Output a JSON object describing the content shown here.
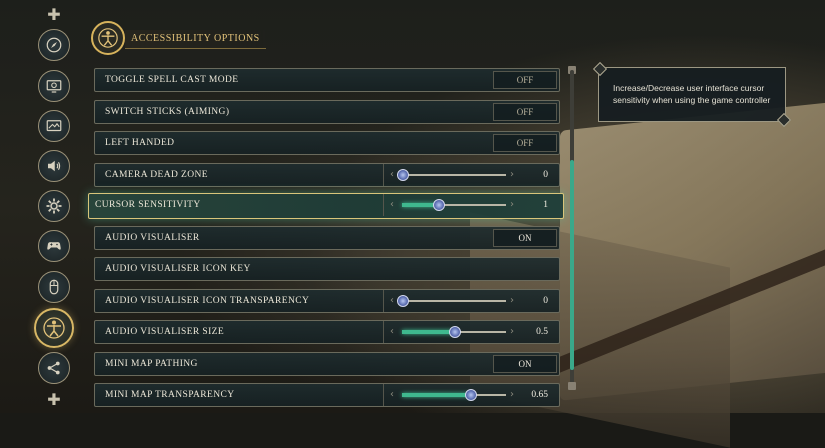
{
  "header": {
    "title": "ACCESSIBILITY OPTIONS",
    "emblem_icon": "vitruvian-man-icon"
  },
  "sidebar": {
    "items": [
      {
        "icon": "compass-icon",
        "active": false
      },
      {
        "icon": "display-icon",
        "active": false
      },
      {
        "icon": "graphics-icon",
        "active": false
      },
      {
        "icon": "speaker-icon",
        "active": false
      },
      {
        "icon": "gear-icon",
        "active": false
      },
      {
        "icon": "gamepad-icon",
        "active": false
      },
      {
        "icon": "mouse-icon",
        "active": false
      },
      {
        "icon": "vitruvian-man-icon",
        "active": true
      },
      {
        "icon": "network-icon",
        "active": false
      }
    ]
  },
  "settings": [
    {
      "label": "TOGGLE SPELL CAST MODE",
      "type": "toggle",
      "value": "OFF"
    },
    {
      "label": "SWITCH STICKS (AIMING)",
      "type": "toggle",
      "value": "OFF"
    },
    {
      "label": "LEFT HANDED",
      "type": "toggle",
      "value": "OFF"
    },
    {
      "label": "CAMERA DEAD ZONE",
      "type": "slider",
      "value": "0",
      "fraction": 0.0
    },
    {
      "label": "CURSOR SENSITIVITY",
      "type": "slider",
      "value": "1",
      "fraction": 0.35,
      "selected": true
    },
    {
      "label": "AUDIO VISUALISER",
      "type": "toggle",
      "value": "ON"
    },
    {
      "label": "AUDIO VISUALISER ICON KEY",
      "type": "link"
    },
    {
      "label": "AUDIO VISUALISER ICON TRANSPARENCY",
      "type": "slider",
      "value": "0",
      "fraction": 0.0
    },
    {
      "label": "AUDIO VISUALISER SIZE",
      "type": "slider",
      "value": "0.5",
      "fraction": 0.5
    },
    {
      "label": "MINI MAP PATHING",
      "type": "toggle",
      "value": "ON"
    },
    {
      "label": "MINI MAP TRANSPARENCY",
      "type": "slider",
      "value": "0.65",
      "fraction": 0.65
    }
  ],
  "tooltip": {
    "text": "Increase/Decrease user interface cursor sensitivity when using the game controller"
  },
  "scroll": {
    "position": 0.3
  },
  "colors": {
    "accent": "#d7b35c",
    "slider_fill": "#3fb88e",
    "selected_border": "#d9c57a"
  }
}
